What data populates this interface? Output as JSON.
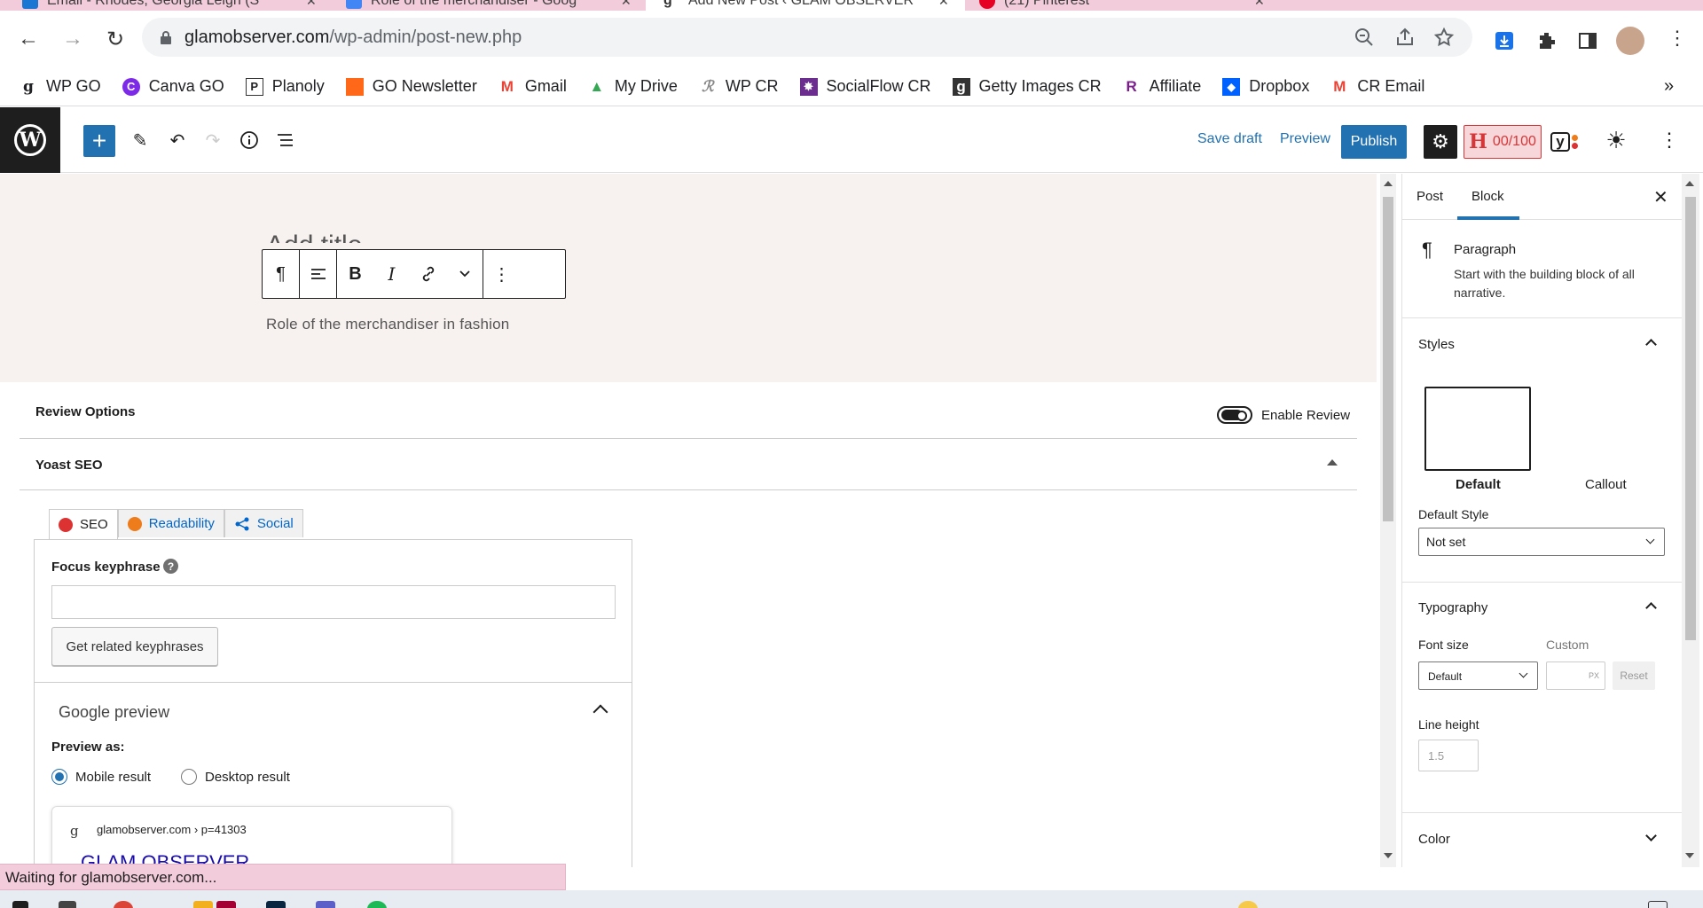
{
  "browser": {
    "tabs": [
      {
        "label": "Email - Rhodes, Georgia Leigh (S",
        "active": false
      },
      {
        "label": "Role of the merchandiser - Goog",
        "active": false
      },
      {
        "label": "Add New Post ‹ GLAM OBSERVER",
        "active": true
      },
      {
        "label": "(21) Pinterest",
        "active": false
      }
    ],
    "url_domain": "glamobserver.com",
    "url_path": "/wp-admin/post-new.php",
    "bookmarks": [
      {
        "label": "WP GO",
        "icon": "g-logo-icon"
      },
      {
        "label": "Canva GO",
        "icon": "canva-icon"
      },
      {
        "label": "Planoly",
        "icon": "planoly-icon"
      },
      {
        "label": "GO Newsletter",
        "icon": "newsletter-icon"
      },
      {
        "label": "Gmail",
        "icon": "gmail-icon"
      },
      {
        "label": "My Drive",
        "icon": "drive-icon"
      },
      {
        "label": "WP CR",
        "icon": "cr-icon"
      },
      {
        "label": "SocialFlow CR",
        "icon": "socialflow-icon"
      },
      {
        "label": "Getty Images CR",
        "icon": "getty-icon"
      },
      {
        "label": "Affiliate",
        "icon": "affiliate-icon"
      },
      {
        "label": "Dropbox",
        "icon": "dropbox-icon"
      },
      {
        "label": "CR Email",
        "icon": "gmail-icon"
      }
    ],
    "more_bookmarks": "»",
    "status_text": "Waiting for glamobserver.com..."
  },
  "wp_header": {
    "save_draft": "Save draft",
    "preview": "Preview",
    "publish": "Publish",
    "headline_h": "H",
    "headline_score": "00/100",
    "yoast_y": "y"
  },
  "editor": {
    "paragraph_text": "Role of the merchandiser in fashion",
    "title_peek": "Add title"
  },
  "review_options": {
    "title": "Review Options",
    "toggle_label": "Enable Review"
  },
  "yoast": {
    "title": "Yoast SEO",
    "tabs": [
      {
        "label": "SEO",
        "color": "#dc3232"
      },
      {
        "label": "Readability",
        "color": "#ee7c1b"
      },
      {
        "label": "Social"
      }
    ],
    "focus_keyphrase_label": "Focus keyphrase",
    "help": "?",
    "focus_keyphrase_value": "",
    "related_button": "Get related keyphrases",
    "google_preview_title": "Google preview",
    "preview_as_label": "Preview as:",
    "preview_options": [
      "Mobile result",
      "Desktop result"
    ],
    "preview_selected": "Mobile result",
    "serp_favicon": "g",
    "serp_url": "glamobserver.com › p=41303",
    "serp_title": "GLAM OBSERVER"
  },
  "sidebar": {
    "tabs": [
      "Post",
      "Block"
    ],
    "active_tab": "Block",
    "block_name": "Paragraph",
    "block_desc": "Start with the building block of all narrative.",
    "styles_title": "Styles",
    "style_options": [
      "Default",
      "Callout"
    ],
    "default_style_label": "Default Style",
    "default_style_value": "Not set",
    "typography_title": "Typography",
    "font_size_label": "Font size",
    "custom_label": "Custom",
    "font_size_value": "Default",
    "custom_unit": "PX",
    "reset": "Reset",
    "line_height_label": "Line height",
    "line_height_placeholder": "1.5",
    "color_title": "Color"
  },
  "colors": {
    "wp_blue": "#2271b1",
    "tab_strip_pink": "#f3ccdb",
    "editor_bg": "#f7f1ef",
    "seo_red": "#dc3232"
  }
}
